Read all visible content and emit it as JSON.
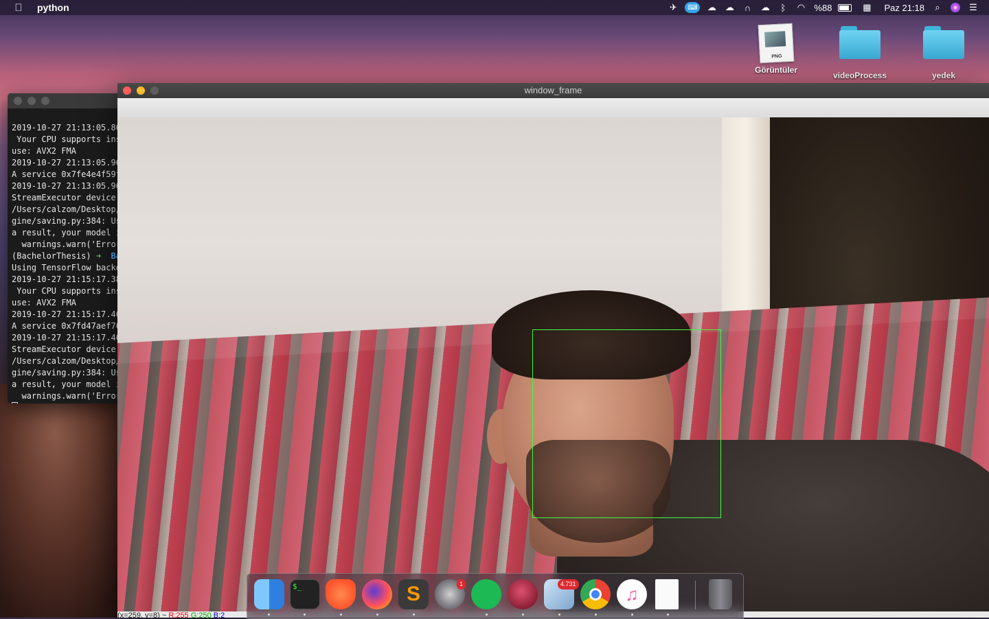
{
  "menubar": {
    "app_name": "python",
    "battery": "%88",
    "clock": "Paz 21:18"
  },
  "desktop": {
    "icons": [
      {
        "label": "Görüntüler",
        "type": "png-document"
      },
      {
        "label": "videoProcess",
        "type": "folder"
      },
      {
        "label": "yedek",
        "type": "folder"
      }
    ]
  },
  "terminal": {
    "lines": [
      "2019-10-27 21:13:05.86",
      " Your CPU supports ins",
      "use: AVX2 FMA",
      "2019-10-27 21:13:05.96",
      "A service 0x7fe4e4f59f",
      "2019-10-27 21:13:05.96",
      "StreamExecutor device",
      "/Users/calzom/Desktop/",
      "gine/saving.py:384: Us",
      "a result, your model i",
      "  warnings.warn('Error"
    ],
    "prompt_env": "(BachelorThesis)",
    "prompt_arrow": "➜",
    "prompt_dir": "Ba",
    "lines2": [
      "Using TensorFlow backe",
      "2019-10-27 21:15:17.38",
      " Your CPU supports ins",
      "use: AVX2 FMA",
      "2019-10-27 21:15:17.46",
      "A service 0x7fd47aef76",
      "2019-10-27 21:15:17.46",
      "StreamExecutor device",
      "/Users/calzom/Desktop/",
      "gine/saving.py:384: Us",
      "a result, your model i",
      "  warnings.warn('Error"
    ]
  },
  "window": {
    "title": "window_frame",
    "status_coords": "(x=259, y=8) ~",
    "status_r": "R:255",
    "status_g": "G:250",
    "status_b": "B:2"
  },
  "dock": {
    "apps": [
      {
        "name": "Finder",
        "icon": "finder-icon",
        "color": "#3d8ff0"
      },
      {
        "name": "Terminal",
        "icon": "terminal-icon",
        "color": "#2b2b2b"
      },
      {
        "name": "Brave",
        "icon": "brave-icon",
        "color": "#fb542b"
      },
      {
        "name": "Firefox",
        "icon": "firefox-icon",
        "color": "#ff7139"
      },
      {
        "name": "Sublime Text",
        "icon": "sublime-icon",
        "color": "#ff9800"
      },
      {
        "name": "System Preferences",
        "icon": "gear-icon",
        "color": "#8e8e93",
        "badge": "1"
      },
      {
        "name": "Spotify",
        "icon": "spotify-icon",
        "color": "#1db954"
      },
      {
        "name": "RAR",
        "icon": "rar-icon",
        "color": "#8a2035"
      },
      {
        "name": "Mail",
        "icon": "mail-icon",
        "color": "#9fc3e0",
        "badge": "4.731"
      },
      {
        "name": "Chrome",
        "icon": "chrome-icon",
        "color": "#4285f4"
      },
      {
        "name": "iTunes",
        "icon": "music-icon",
        "color": "#f45ca8"
      },
      {
        "name": "Document",
        "icon": "document-icon",
        "color": "#ffffff"
      },
      {
        "name": "Trash",
        "icon": "trash-icon",
        "color": "#7a7a80"
      }
    ]
  }
}
